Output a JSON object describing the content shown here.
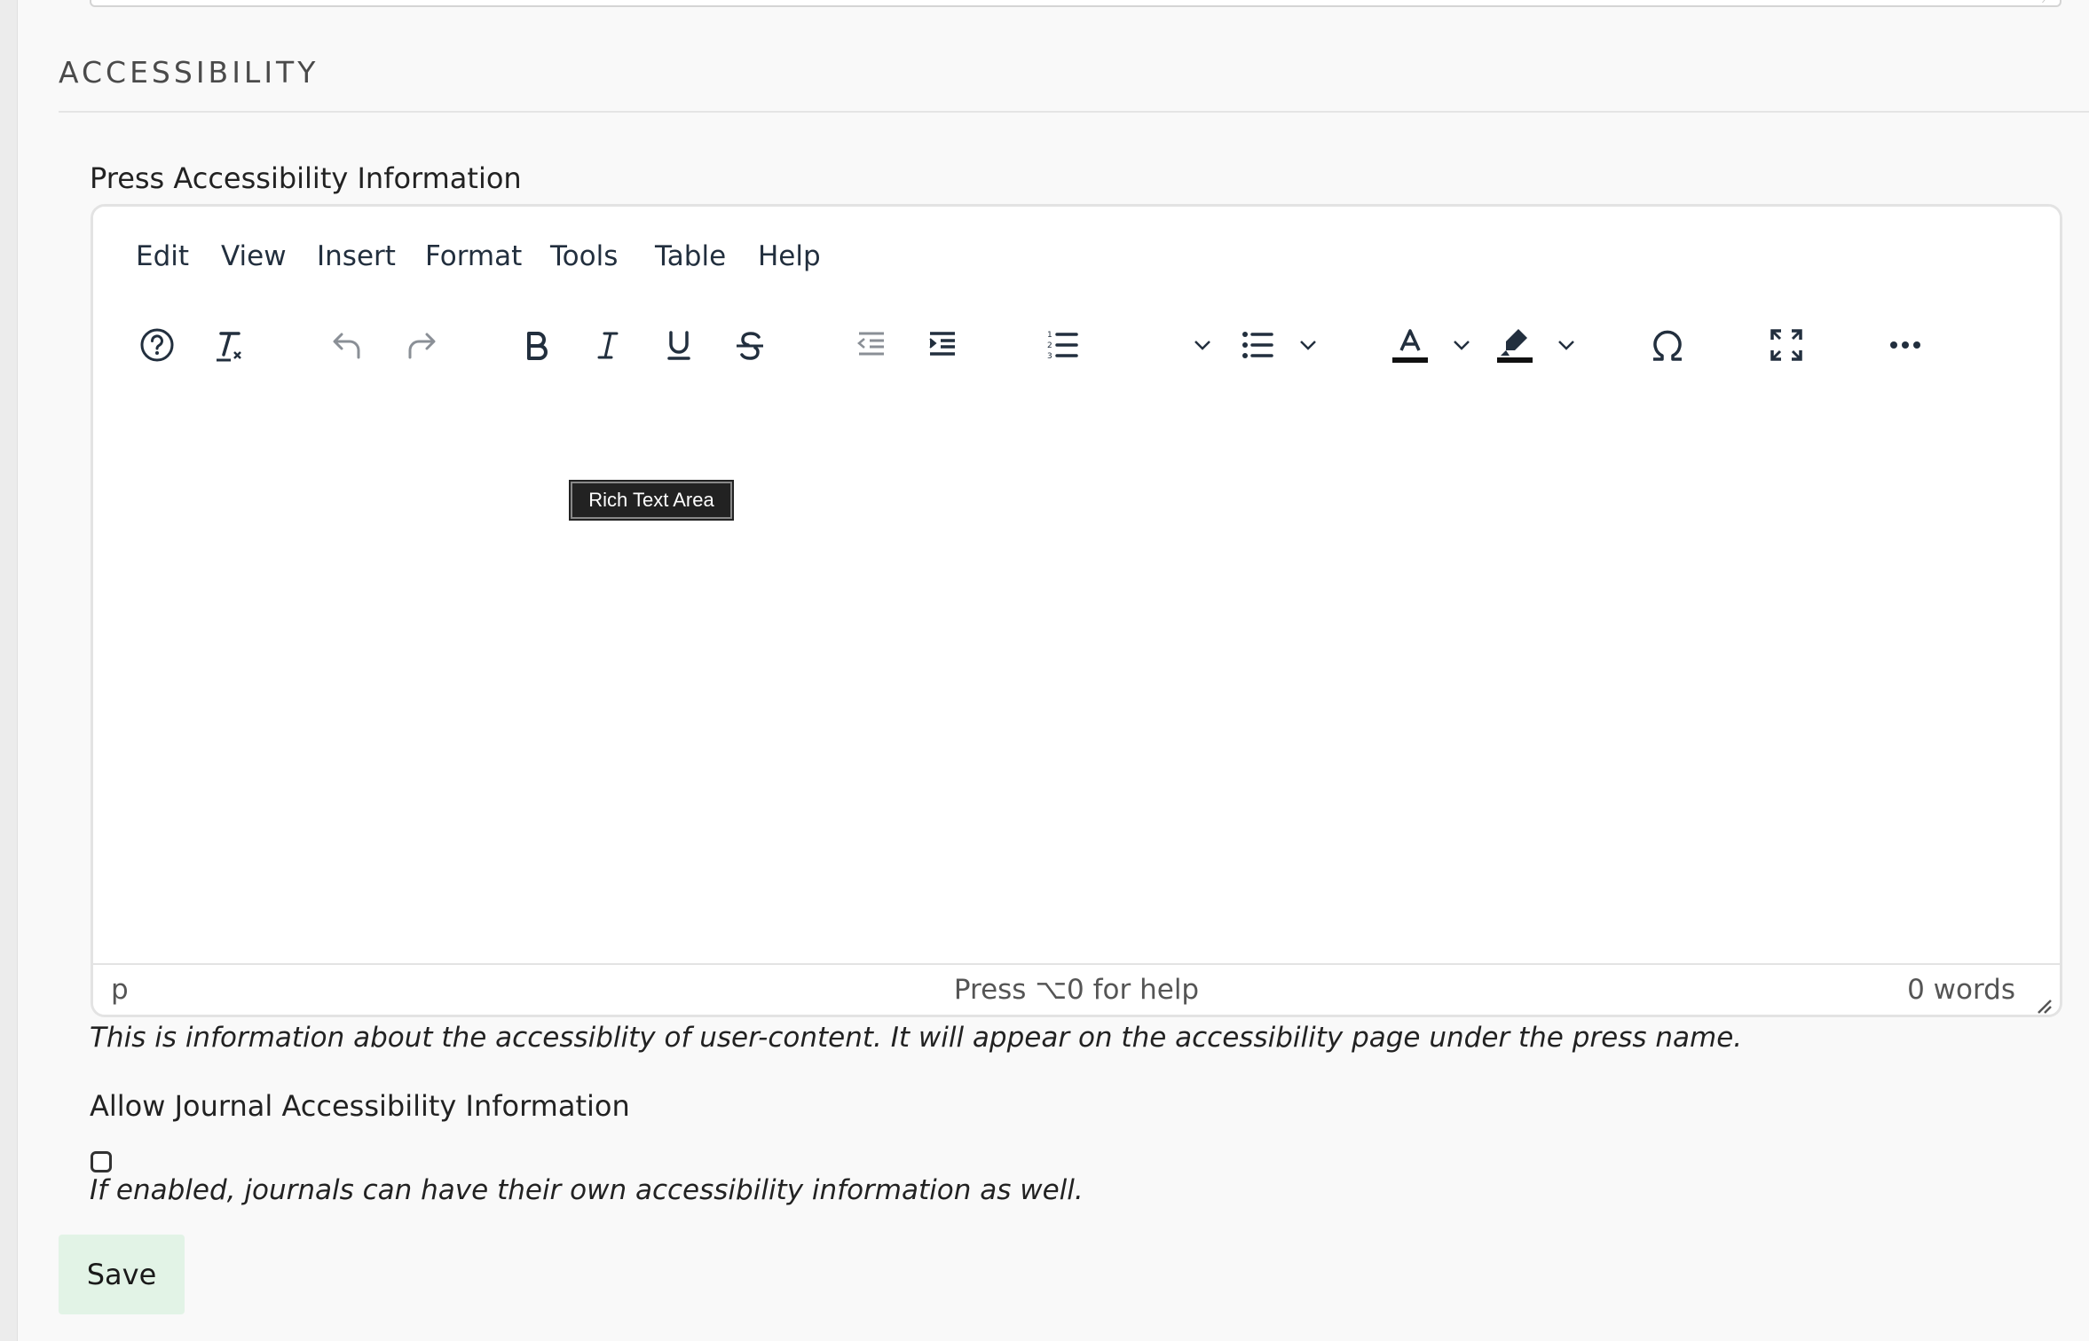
{
  "section": {
    "title": "ACCESSIBILITY"
  },
  "press_field": {
    "label": "Press Accessibility Information",
    "help": "This is information about the accessiblity of user-content. It will appear on the accessibility page under the press name."
  },
  "editor": {
    "menu": [
      "Edit",
      "View",
      "Insert",
      "Format",
      "Tools",
      "Table",
      "Help"
    ],
    "toolbar_icons": [
      "help-icon",
      "clear-formatting-icon",
      "undo-icon",
      "redo-icon",
      "bold-icon",
      "italic-icon",
      "underline-icon",
      "strikethrough-icon",
      "outdent-icon",
      "indent-icon",
      "numbered-list-icon",
      "bullet-list-icon",
      "text-color-icon",
      "highlight-color-icon",
      "special-character-icon",
      "fullscreen-icon",
      "more-icon"
    ],
    "tooltip": "Rich Text Area",
    "status_path": "p",
    "status_help": "Press ⌥0 for help",
    "word_count": "0 words",
    "content": ""
  },
  "journal_field": {
    "label": "Allow Journal Accessibility Information",
    "checked": false,
    "help": "If enabled, journals can have their own accessibility information as well."
  },
  "actions": {
    "save_label": "Save"
  },
  "colors": {
    "save_bg": "#e2f3e6",
    "toolbar_icon": "#222f3e",
    "disabled_icon": "#8a8f96"
  }
}
